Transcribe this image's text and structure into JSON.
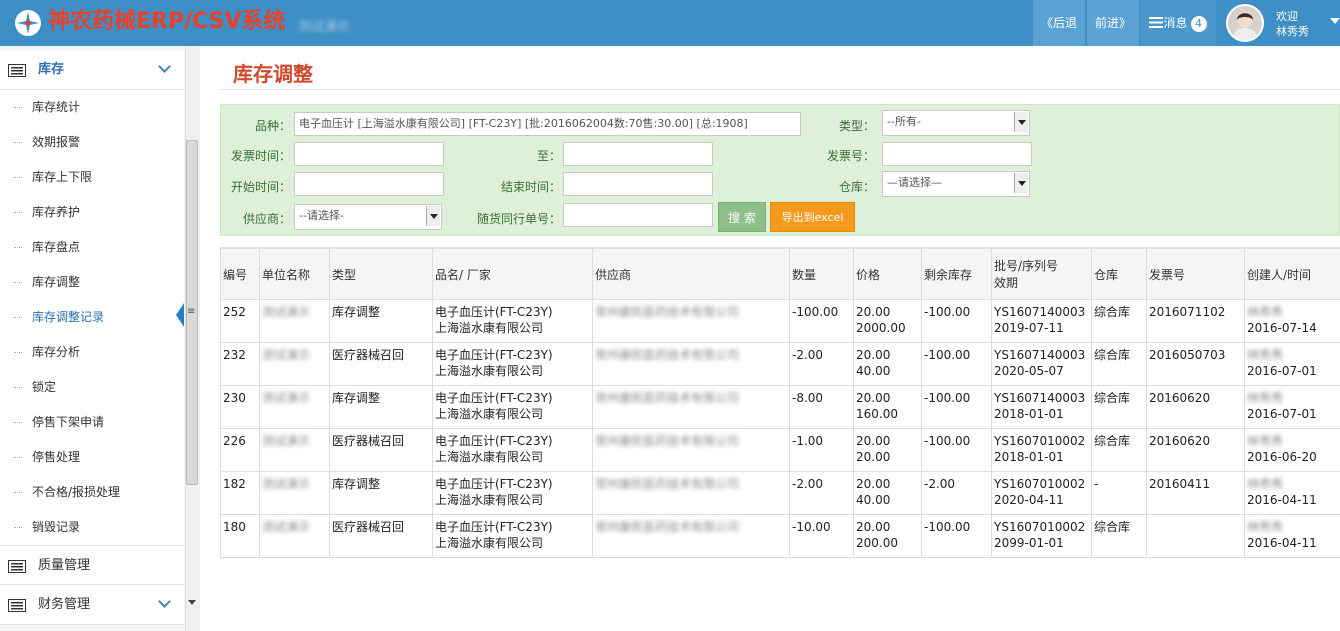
{
  "header": {
    "title": "神农药械ERP/CSV系统",
    "subtitle": "测试演示",
    "back_label": "《后退",
    "forward_label": "前进》",
    "messages_label": "消息",
    "messages_count": "4",
    "welcome": "欢迎",
    "user_name": "林秀秀"
  },
  "sidebar": {
    "stock_section": "库存",
    "items": [
      "库存统计",
      "效期报警",
      "库存上下限",
      "库存养护",
      "库存盘点",
      "库存调整",
      "库存调整记录",
      "库存分析",
      "锁定",
      "停售下架申请",
      "停售处理",
      "不合格/报损处理",
      "销毁记录"
    ],
    "active_item": "库存调整记录",
    "quality_section": "质量管理",
    "finance_section": "财务管理",
    "grip": "≡"
  },
  "main": {
    "page_title": "库存调整"
  },
  "filter": {
    "product_label": "品种：",
    "product_value": "电子血压计 [上海溢水康有限公司] [FT-C23Y] [批:2016062004数:70售:30.00] [总:1908]",
    "type_label": "类型：",
    "type_value": "--所有-",
    "invoice_time_label": "发票时间：",
    "to_label": "至：",
    "invoice_no_label": "发票号：",
    "start_time_label": "开始时间：",
    "end_time_label": "结束时间：",
    "warehouse_label": "仓库：",
    "warehouse_value": "—请选择—",
    "supplier_label": "供应商：",
    "supplier_value": "--请选择-",
    "delivery_no_label": "随货同行单号：",
    "search_label": "搜 索",
    "export_label": "导出到excel"
  },
  "table": {
    "headers": [
      "编号",
      "单位名称",
      "类型",
      "品名/ 厂家",
      "供应商",
      "数量",
      "价格",
      "剩余库存",
      "批号/序列号",
      "仓库",
      "发票号",
      "创建人/时间"
    ],
    "header_batch_sub": "效期",
    "rows": [
      {
        "id": "252",
        "unit": "测试演示",
        "type": "库存调整",
        "product": "电子血压计(FT-C23Y)",
        "maker": "上海溢水康有限公司",
        "supplier": "常州康民医药技术有限公司",
        "qty": "-100.00",
        "price": "20.00",
        "amount": "2000.00",
        "remain": "-100.00",
        "batch": "YS1607140003",
        "expiry": "2019-07-11",
        "warehouse": "综合库",
        "invoice": "2016071102",
        "creator": "林秀秀",
        "date": "2016-07-14"
      },
      {
        "id": "232",
        "unit": "测试演示",
        "type": "医疗器械召回",
        "product": "电子血压计(FT-C23Y)",
        "maker": "上海溢水康有限公司",
        "supplier": "常州康民医药技术有限公司",
        "qty": "-2.00",
        "price": "20.00",
        "amount": "40.00",
        "remain": "-100.00",
        "batch": "YS1607140003",
        "expiry": "2020-05-07",
        "warehouse": "综合库",
        "invoice": "2016050703",
        "creator": "林秀秀",
        "date": "2016-07-01"
      },
      {
        "id": "230",
        "unit": "测试演示",
        "type": "库存调整",
        "product": "电子血压计(FT-C23Y)",
        "maker": "上海溢水康有限公司",
        "supplier": "常州康民医药技术有限公司",
        "qty": "-8.00",
        "price": "20.00",
        "amount": "160.00",
        "remain": "-100.00",
        "batch": "YS1607140003",
        "expiry": "2018-01-01",
        "warehouse": "综合库",
        "invoice": "20160620",
        "creator": "林秀秀",
        "date": "2016-07-01"
      },
      {
        "id": "226",
        "unit": "测试演示",
        "type": "医疗器械召回",
        "product": "电子血压计(FT-C23Y)",
        "maker": "上海溢水康有限公司",
        "supplier": "常州康民医药技术有限公司",
        "qty": "-1.00",
        "price": "20.00",
        "amount": "20.00",
        "remain": "-100.00",
        "batch": "YS1607010002",
        "expiry": "2018-01-01",
        "warehouse": "综合库",
        "invoice": "20160620",
        "creator": "林秀秀",
        "date": "2016-06-20"
      },
      {
        "id": "182",
        "unit": "测试演示",
        "type": "库存调整",
        "product": "电子血压计(FT-C23Y)",
        "maker": "上海溢水康有限公司",
        "supplier": "常州康民医药技术有限公司",
        "qty": "-2.00",
        "price": "20.00",
        "amount": "40.00",
        "remain": "-2.00",
        "batch": "YS1607010002",
        "expiry": "2020-04-11",
        "warehouse": "-",
        "invoice": "20160411",
        "creator": "林秀秀",
        "date": "2016-04-11"
      },
      {
        "id": "180",
        "unit": "测试演示",
        "type": "医疗器械召回",
        "product": "电子血压计(FT-C23Y)",
        "maker": "上海溢水康有限公司",
        "supplier": "常州康民医药技术有限公司",
        "qty": "-10.00",
        "price": "20.00",
        "amount": "200.00",
        "remain": "-100.00",
        "batch": "YS1607010002",
        "expiry": "2099-01-01",
        "warehouse": "综合库",
        "invoice": "",
        "creator": "林秀秀",
        "date": "2016-04-11"
      }
    ]
  }
}
